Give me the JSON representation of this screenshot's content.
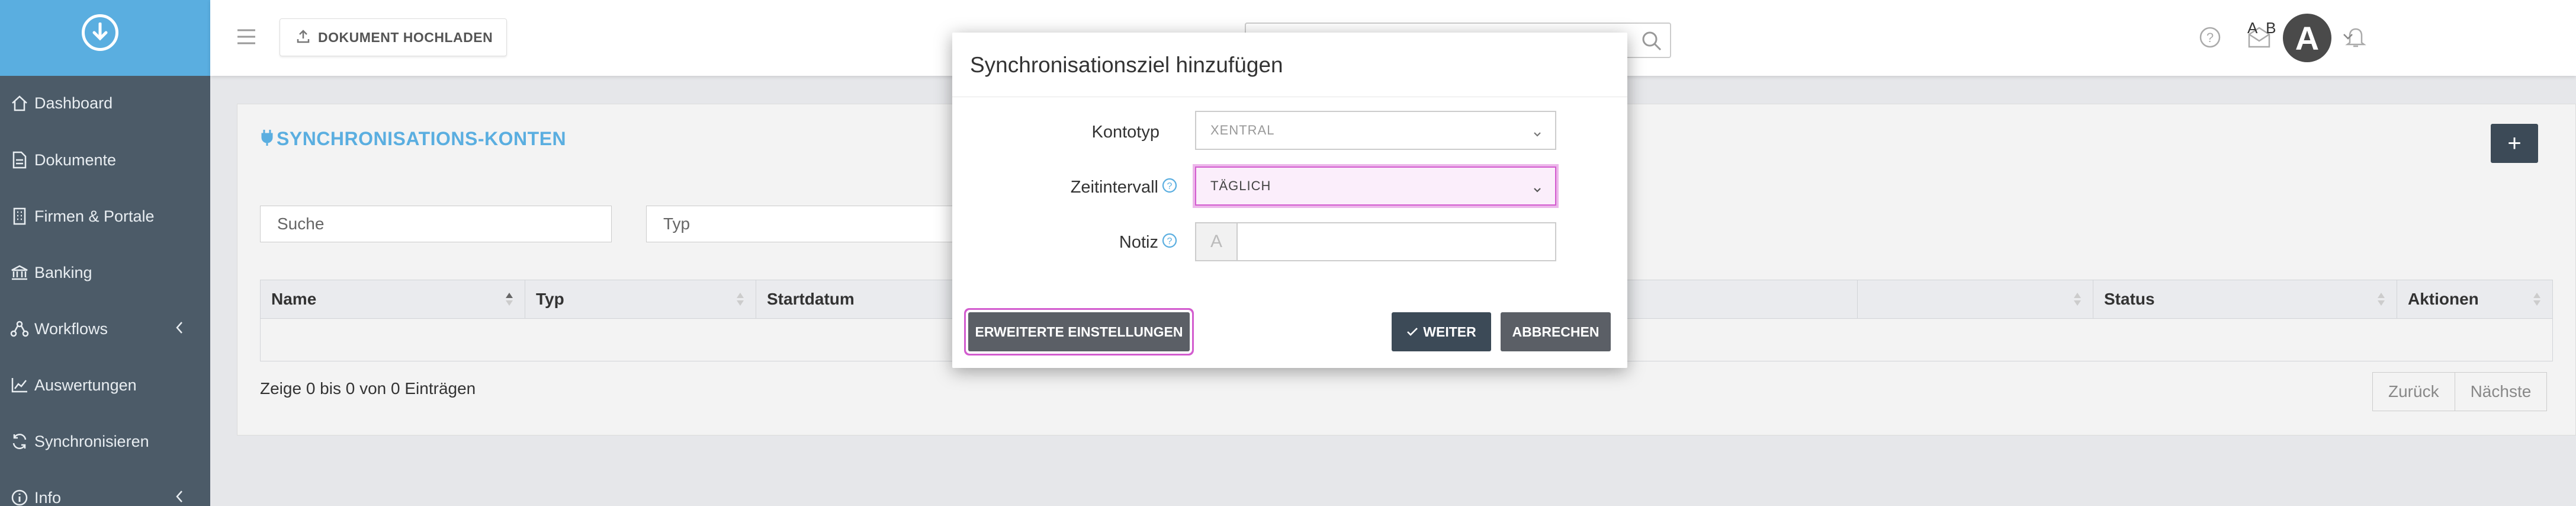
{
  "sidebar": {
    "items": [
      {
        "label": "Dashboard",
        "icon": "home-icon"
      },
      {
        "label": "Dokumente",
        "icon": "document-icon"
      },
      {
        "label": "Firmen & Portale",
        "icon": "building-icon"
      },
      {
        "label": "Banking",
        "icon": "bank-icon"
      },
      {
        "label": "Workflows",
        "icon": "workflow-icon"
      },
      {
        "label": "Auswertungen",
        "icon": "chart-icon"
      },
      {
        "label": "Synchronisieren",
        "icon": "sync-icon"
      },
      {
        "label": "Info",
        "icon": "info-icon"
      }
    ]
  },
  "topbar": {
    "upload_label": "DOKUMENT HOCHLADEN",
    "search_placeholder": "",
    "user_initials": "A B",
    "avatar_letter": "A"
  },
  "card": {
    "title": "SYNCHRONISATIONS-KONTEN",
    "filter_search_placeholder": "Suche",
    "filter_type_placeholder": "Typ",
    "columns": [
      "Name",
      "Typ",
      "Startdatum",
      "",
      "Status",
      "Aktionen"
    ],
    "info": "Zeige 0 bis 0 von 0 Einträgen",
    "pager": {
      "prev": "Zurück",
      "next": "Nächste"
    }
  },
  "modal": {
    "title": "Synchronisationsziel hinzufügen",
    "fields": {
      "kontotyp_label": "Kontotyp",
      "kontotyp_value": "XENTRAL",
      "zeitintervall_label": "Zeitintervall",
      "zeitintervall_value": "TÄGLICH",
      "notiz_label": "Notiz",
      "notiz_addon": "A",
      "notiz_value": ""
    },
    "buttons": {
      "extended": "ERWEITERTE EINSTELLUNGEN",
      "next": "WEITER",
      "cancel": "ABBRECHEN"
    }
  },
  "colors": {
    "accent_blue": "#5aaee0",
    "sidebar_bg": "#4c5b68",
    "highlight_pink": "#d35ccf",
    "primary_dark": "#3c4a57"
  }
}
